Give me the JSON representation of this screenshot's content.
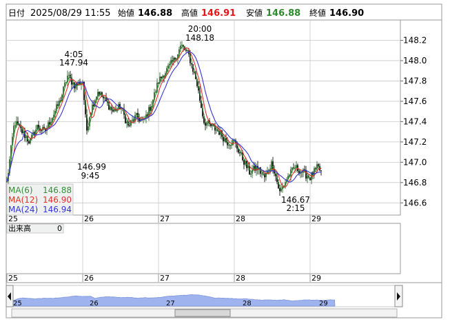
{
  "header": {
    "date_label": "日付",
    "datetime": "2025/08/29 11:55",
    "open_label": "始値",
    "open": "146.88",
    "high_label": "高値",
    "high": "146.91",
    "low_label": "安値",
    "low": "146.88",
    "close_label": "終値",
    "close": "146.90"
  },
  "colors": {
    "up_candle": "#2e6b2e",
    "down_candle": "#111111",
    "ma6": "#3a8a3a",
    "ma12": "#e0302a",
    "ma24": "#3434d8",
    "high_text": "#e8141a",
    "low_text": "#2e8a2e",
    "navigator_fill": "#9fb4ee",
    "grid": "#c8c8c8"
  },
  "legend": [
    {
      "key": "ma6",
      "label": "MA(6)",
      "value": "146.88"
    },
    {
      "key": "ma12",
      "label": "MA(12)",
      "value": "146.90"
    },
    {
      "key": "ma24",
      "label": "MA(24)",
      "value": "146.94"
    }
  ],
  "volume_panel": {
    "label": "出来高",
    "value": "0"
  },
  "annotations": {
    "a1_time": "4:05",
    "a1_price": "147.94",
    "a2_time": "20:00",
    "a2_price": "148.18",
    "a3_price": "146.99",
    "a3_time": "9:45",
    "a4_price": "146.67",
    "a4_time": "2:15"
  },
  "chart_data": {
    "type": "candlestick",
    "xlabel": "",
    "ylabel": "",
    "ylim": [
      146.48,
      148.4
    ],
    "y_ticks": [
      "146.6",
      "146.8",
      "147.0",
      "147.2",
      "147.4",
      "147.6",
      "147.8",
      "148.0",
      "148.2"
    ],
    "x_tick_labels": [
      "25",
      "26",
      "27",
      "28",
      "29"
    ],
    "grid": true,
    "legend_position": "bottom-left",
    "series": [
      {
        "name": "price",
        "x_day": [
          25.0,
          25.1,
          25.2,
          25.3,
          25.4,
          25.5,
          25.6,
          25.7,
          25.8,
          25.9,
          26.0,
          26.05,
          26.1,
          26.2,
          26.3,
          26.4,
          26.5,
          26.6,
          26.7,
          26.8,
          26.9,
          27.0,
          27.1,
          27.2,
          27.3,
          27.4,
          27.5,
          27.6,
          27.7,
          27.8,
          27.9,
          28.0,
          28.1,
          28.2,
          28.3,
          28.4,
          28.5,
          28.6,
          28.7,
          28.8,
          28.9,
          29.0,
          29.1,
          29.15
        ],
        "y": [
          146.8,
          147.4,
          147.3,
          147.2,
          147.35,
          147.3,
          147.45,
          147.6,
          147.85,
          147.75,
          147.8,
          147.3,
          147.5,
          147.7,
          147.6,
          147.5,
          147.55,
          147.35,
          147.45,
          147.4,
          147.55,
          147.8,
          147.9,
          148.0,
          148.15,
          148.05,
          147.8,
          147.4,
          147.35,
          147.3,
          147.2,
          147.2,
          147.05,
          146.9,
          146.95,
          146.85,
          147.0,
          146.7,
          146.85,
          146.95,
          146.9,
          146.85,
          146.95,
          146.9
        ]
      }
    ],
    "annotations": [
      {
        "label": "4:05 147.94",
        "day": 25.8,
        "y": 147.94
      },
      {
        "label": "20:00 148.18",
        "day": 27.5,
        "y": 148.18
      },
      {
        "label": "146.99 9:45",
        "day": 26.05,
        "y": 146.99
      },
      {
        "label": "146.67 2:15",
        "day": 28.65,
        "y": 146.67
      }
    ]
  }
}
